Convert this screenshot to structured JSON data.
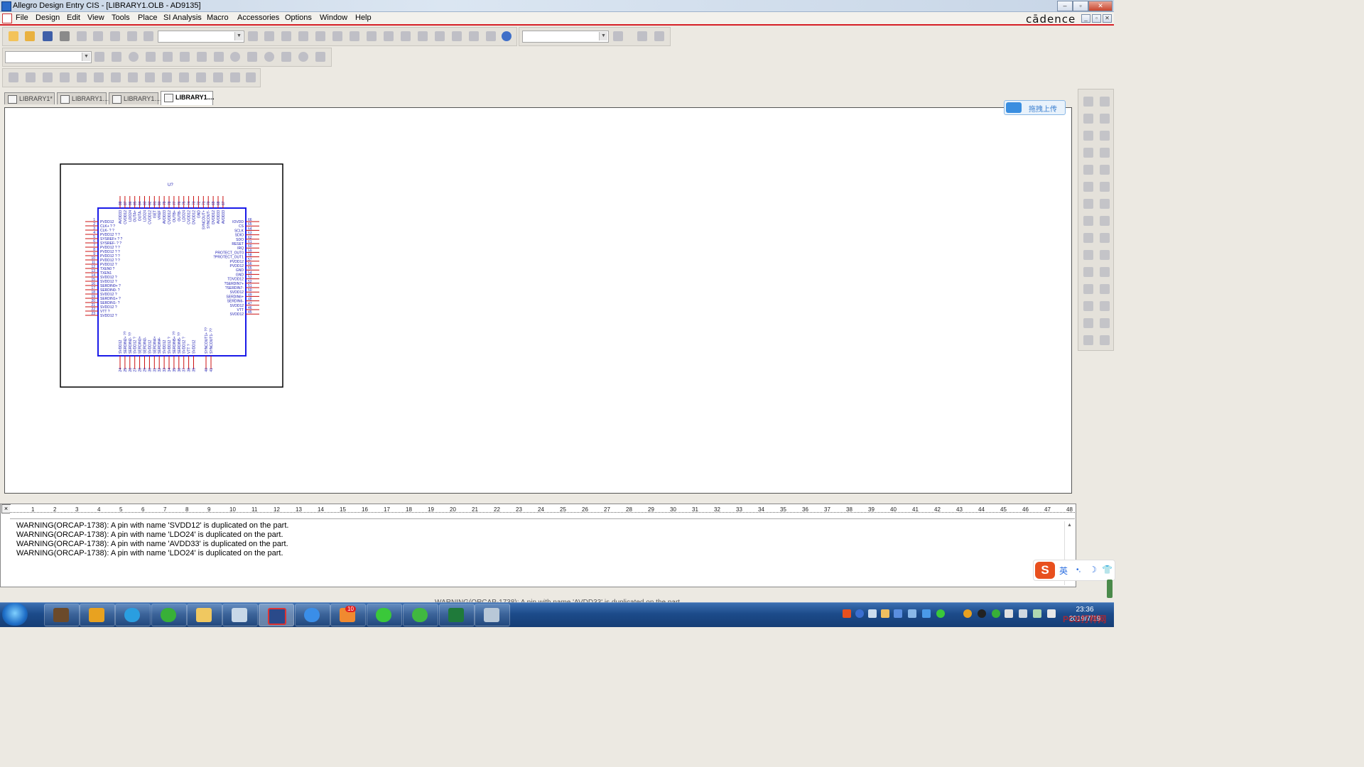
{
  "window": {
    "title": "Allegro Design Entry CIS - [LIBRARY1.OLB - AD9135]",
    "brand": "cādence",
    "controls": {
      "minimize": "–",
      "restore": "▫",
      "close": "✕"
    },
    "mdi_controls": {
      "minimize": "_",
      "restore": "▫",
      "close": "✕"
    }
  },
  "menu": [
    "File",
    "Design",
    "Edit",
    "View",
    "Tools",
    "Place",
    "SI Analysis",
    "Macro",
    "Accessories",
    "Options",
    "Window",
    "Help"
  ],
  "toolbar": {
    "combo1_value": "",
    "combo2_value": "",
    "combo3_value": ""
  },
  "tabs": [
    {
      "label": "LIBRARY1*",
      "active": false
    },
    {
      "label": "LIBRARY1....",
      "active": false
    },
    {
      "label": "LIBRARY1....",
      "active": false
    },
    {
      "label": "LIBRARY1....",
      "active": true
    }
  ],
  "upload_button": "拖拽上传",
  "part": {
    "refdes": "U?",
    "left_pins": [
      {
        "num": "1",
        "name": "PVDD12"
      },
      {
        "num": "2",
        "name": "CLK+ ? ?"
      },
      {
        "num": "3",
        "name": "CLK- ? ?"
      },
      {
        "num": "4",
        "name": "PVDD12 ? ?"
      },
      {
        "num": "5",
        "name": "SYSREF+ ? ?"
      },
      {
        "num": "6",
        "name": "SYSREF- ? ?"
      },
      {
        "num": "7",
        "name": "PVDD12 ? ?"
      },
      {
        "num": "8",
        "name": "PVDD12 ? ?"
      },
      {
        "num": "9",
        "name": "PVDD12 ? ?"
      },
      {
        "num": "10",
        "name": "PVDD12 ? ?"
      },
      {
        "num": "11",
        "name": "PVDD12 ?"
      },
      {
        "num": "12",
        "name": "TXEN0 ?"
      },
      {
        "num": "13",
        "name": "TXEN1"
      },
      {
        "num": "14",
        "name": "SVDD12 ?"
      },
      {
        "num": "15",
        "name": "SVDD12 ?"
      },
      {
        "num": "16",
        "name": "SERDIN0+ ?"
      },
      {
        "num": "17",
        "name": "SERDIN0- ?"
      },
      {
        "num": "18",
        "name": "SVDD12 ?"
      },
      {
        "num": "19",
        "name": "SERDIN1+ ?"
      },
      {
        "num": "20",
        "name": "SERDIN1- ?"
      },
      {
        "num": "21",
        "name": "SVDD12 ?"
      },
      {
        "num": "22",
        "name": "VTT ?"
      },
      {
        "num": "23",
        "name": "SVDD12 ?"
      }
    ],
    "right_pins": [
      {
        "num": "66",
        "name": "IOVDD"
      },
      {
        "num": "65",
        "name": "CS"
      },
      {
        "num": "64",
        "name": "SCLK"
      },
      {
        "num": "63",
        "name": "SDIO"
      },
      {
        "num": "62",
        "name": "SDO"
      },
      {
        "num": "61",
        "name": "RESET"
      },
      {
        "num": "60",
        "name": "IRQ"
      },
      {
        "num": "59",
        "name": "PROTECT_OUT0"
      },
      {
        "num": "58",
        "name": "?PROTECT_OUT1"
      },
      {
        "num": "57",
        "name": "PVDD12"
      },
      {
        "num": "56",
        "name": "PVDD12"
      },
      {
        "num": "55",
        "name": "GND"
      },
      {
        "num": "54",
        "name": "GND"
      },
      {
        "num": "53",
        "name": "TDVDD12"
      },
      {
        "num": "52",
        "name": "?SERDIN7+"
      },
      {
        "num": "51",
        "name": "?SERDIN7-"
      },
      {
        "num": "50",
        "name": "SVDD12"
      },
      {
        "num": "49",
        "name": "SERDIN6+"
      },
      {
        "num": "48",
        "name": "SERDIN6-"
      },
      {
        "num": "47",
        "name": "SVDD12"
      },
      {
        "num": "46",
        "name": "VTT"
      },
      {
        "num": "45",
        "name": "SVDD12"
      }
    ],
    "top_pins": [
      {
        "num": "88",
        "name": "AVDD33"
      },
      {
        "num": "87",
        "name": "CVDD12"
      },
      {
        "num": "86",
        "name": "LDO24"
      },
      {
        "num": "85",
        "name": "OUTA+"
      },
      {
        "num": "84",
        "name": "OUTA-"
      },
      {
        "num": "83",
        "name": "LDO24"
      },
      {
        "num": "82",
        "name": "CVDD12"
      },
      {
        "num": "81",
        "name": "ISET"
      },
      {
        "num": "80",
        "name": "VREF"
      },
      {
        "num": "79",
        "name": "AVDD33"
      },
      {
        "num": "78",
        "name": "CVDD12"
      },
      {
        "num": "77",
        "name": "OUTB+"
      },
      {
        "num": "76",
        "name": "OUTB-"
      },
      {
        "num": "75",
        "name": "LDO24"
      },
      {
        "num": "74",
        "name": "CVDD12"
      },
      {
        "num": "73",
        "name": "DVDD12"
      },
      {
        "num": "72",
        "name": "GND"
      },
      {
        "num": "71",
        "name": "SYNCOUT+"
      },
      {
        "num": "70",
        "name": "SYNCOUT-"
      },
      {
        "num": "69",
        "name": "DVDD12"
      },
      {
        "num": "68",
        "name": "AVDD33"
      },
      {
        "num": "67",
        "name": "AVDD33"
      }
    ],
    "bottom_pins": [
      {
        "num": "24",
        "name": "SVDD12"
      },
      {
        "num": "25",
        "name": "SERDIN2+ ??"
      },
      {
        "num": "26",
        "name": "SERDIN2- ??"
      },
      {
        "num": "27",
        "name": "SVDD12 ?"
      },
      {
        "num": "28",
        "name": "SERDIN3+"
      },
      {
        "num": "29",
        "name": "SERDIN3-"
      },
      {
        "num": "30",
        "name": "SVDD12"
      },
      {
        "num": "31",
        "name": "SERDIN4+"
      },
      {
        "num": "32",
        "name": "SERDIN4-"
      },
      {
        "num": "33",
        "name": "SVDD12"
      },
      {
        "num": "34",
        "name": "SVDD12 ?"
      },
      {
        "num": "35",
        "name": "SERDIN5+ ??"
      },
      {
        "num": "36",
        "name": "SERDIN5- ??"
      },
      {
        "num": "37",
        "name": "SVDD12 ?"
      },
      {
        "num": "38",
        "name": "VTT ?"
      },
      {
        "num": "39",
        "name": "SVDD12"
      },
      {
        "num": "40",
        "name": "SYNCOUT1+ ??"
      },
      {
        "num": "41",
        "name": "SYNCOUT1- ??"
      }
    ]
  },
  "ruler_ticks": [
    "1",
    "2",
    "3",
    "4",
    "5",
    "6",
    "7",
    "8",
    "9",
    "10",
    "11",
    "12",
    "13",
    "14",
    "15",
    "16",
    "17",
    "18",
    "19",
    "20",
    "21",
    "22",
    "23",
    "24",
    "25",
    "26",
    "27",
    "28",
    "29",
    "30",
    "31",
    "32",
    "33",
    "34",
    "35",
    "36",
    "37",
    "38",
    "39",
    "40",
    "41",
    "42",
    "43",
    "44",
    "45",
    "46",
    "47",
    "48"
  ],
  "session_log": [
    "WARNING(ORCAP-1738): A pin with name 'SVDD12' is duplicated on the part.",
    "WARNING(ORCAP-1738): A pin with name 'LDO24' is duplicated on the part.",
    "WARNING(ORCAP-1738): A pin with name 'AVDD33' is duplicated on the part.",
    "WARNING(ORCAP-1738): A pin with name 'LDO24' is duplicated on the part."
  ],
  "status_hint": "WARNING(ORCAP-1738): A pin with name 'AVDD33' is duplicated on the part.",
  "ime": {
    "logo": "S",
    "mode": "英"
  },
  "taskbar": {
    "badge_count": "10",
    "clock_time": "23:36",
    "clock_date": "2019/7/19",
    "watermark": "PCB打样网"
  },
  "colors": {
    "accent_red": "#d61f26",
    "part_body": "#1a1ae8",
    "pin_red": "#cc1111",
    "pin_text": "#1a1ab0"
  }
}
